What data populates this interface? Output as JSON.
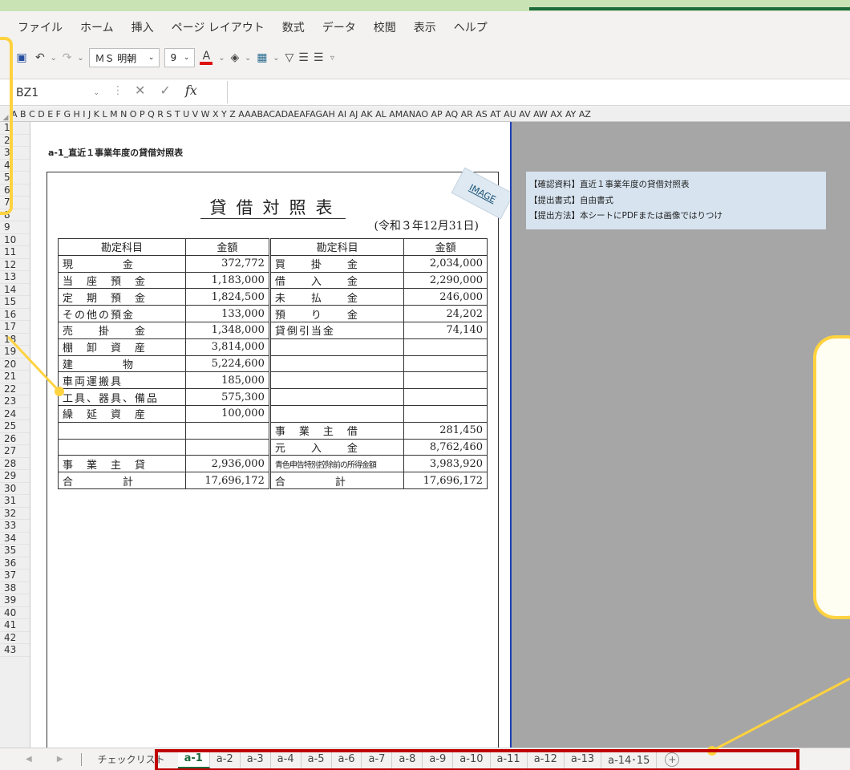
{
  "menu": [
    "ファイル",
    "ホーム",
    "挿入",
    "ページ レイアウト",
    "数式",
    "データ",
    "校閲",
    "表示",
    "ヘルプ"
  ],
  "toolbar": {
    "font_name": "ＭＳ 明朝",
    "font_size": "9",
    "font_color": "A"
  },
  "formula_bar": {
    "cell_ref": "BZ1",
    "fx": "fx",
    "value": ""
  },
  "columns": "A B C D E F G H I J K L M N O P Q R S T U V W X Y Z AAABACADAEAFAGAH AI AJ AK AL AMANAO AP AQ AR AS AT AU AV AW AX AY AZ",
  "rows": [
    "1",
    "2",
    "3",
    "4",
    "5",
    "6",
    "7",
    "8",
    "9",
    "10",
    "11",
    "12",
    "13",
    "14",
    "15",
    "16",
    "17",
    "18",
    "19",
    "20",
    "21",
    "22",
    "23",
    "24",
    "25",
    "26",
    "27",
    "28",
    "29",
    "30",
    "31",
    "32",
    "33",
    "34",
    "35",
    "36",
    "37",
    "38",
    "39",
    "40",
    "41",
    "42",
    "43"
  ],
  "sheet_title": "a-1_直近１事業年度の貸借対照表",
  "image_label": "IMAGE",
  "document": {
    "title": "貸借対照表",
    "date": "(令和３年12月31日)",
    "headers": [
      "勘定科目",
      "金額",
      "勘定科目",
      "金額"
    ],
    "rows": [
      [
        "現　　　　金",
        "372,772",
        "買　　掛　　金",
        "2,034,000"
      ],
      [
        "当　座　預　金",
        "1,183,000",
        "借　　入　　金",
        "2,290,000"
      ],
      [
        "定　期　預　金",
        "1,824,500",
        "未　　払　　金",
        "246,000"
      ],
      [
        "その他の預金",
        "133,000",
        "預　　り　　金",
        "24,202"
      ],
      [
        "売　　掛　　金",
        "1,348,000",
        "貸倒引当金",
        "74,140"
      ],
      [
        "棚　卸　資　産",
        "3,814,000",
        "",
        ""
      ],
      [
        "建　　　　物",
        "5,224,600",
        "",
        ""
      ],
      [
        "車両運搬具",
        "185,000",
        "",
        ""
      ],
      [
        "工具、器具、備品",
        "575,300",
        "",
        ""
      ],
      [
        "繰　延　資　産",
        "100,000",
        "",
        ""
      ],
      [
        "",
        "",
        "事　業　主　借",
        "281,450"
      ],
      [
        "",
        "",
        "元　　入　　金",
        "8,762,460"
      ],
      [
        "事　業　主　貸",
        "2,936,000",
        "青色申告特別控除前の所得金額",
        "3,983,920"
      ],
      [
        "合　　　　計",
        "17,696,172",
        "合　　　　計",
        "17,696,172"
      ]
    ]
  },
  "info": [
    "【確認資料】直近１事業年度の貸借対照表",
    "【提出書式】自由書式",
    "【提出方法】本シートにPDFまたは画像ではりつけ"
  ],
  "tabs": {
    "nav": "◀ ▶",
    "checklist": "チェックリスト",
    "items": [
      "a-1",
      "a-2",
      "a-3",
      "a-4",
      "a-5",
      "a-6",
      "a-7",
      "a-8",
      "a-9",
      "a-10",
      "a-11",
      "a-12",
      "a-13",
      "a-14･15"
    ],
    "active": "a-1",
    "add": "+"
  },
  "colors": {
    "excel_green": "#1e6b3c",
    "highlight_yellow": "#ffd23f",
    "box_red": "#c00000",
    "page_border_blue": "#1f3fb6",
    "info_bg": "#d7e4f0"
  }
}
